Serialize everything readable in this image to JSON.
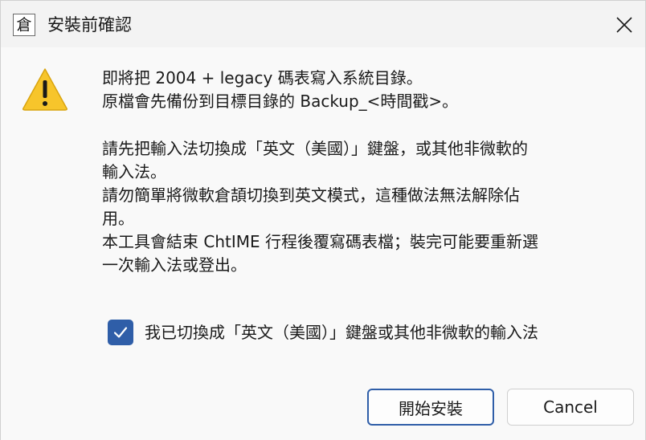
{
  "window": {
    "icon_glyph": "倉",
    "title": "安裝前確認",
    "close_icon": "close-icon"
  },
  "message": {
    "paragraph1": "即將把 2004 + legacy 碼表寫入系統目錄。\n原檔會先備份到目標目錄的 Backup_<時間戳>。",
    "paragraph2": "請先把輸入法切換成「英文（美國）」鍵盤，或其他非微軟的\n輸入法。\n請勿簡單將微軟倉頡切換到英文模式，這種做法無法解除佔\n用。\n本工具會結束 ChtIME 行程後覆寫碼表檔；裝完可能要重新選\n一次輸入法或登出。"
  },
  "confirm_checkbox": {
    "checked": true,
    "label": "我已切換成「英文（美國）」鍵盤或其他非微軟的輸入法"
  },
  "buttons": {
    "install_label": "開始安裝",
    "cancel_label": "Cancel"
  },
  "colors": {
    "accent": "#2f5ea8",
    "warning": "#f7c52b"
  }
}
